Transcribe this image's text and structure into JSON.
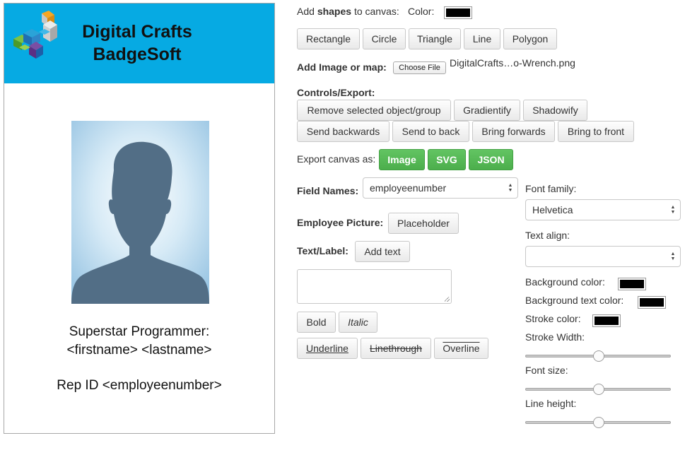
{
  "badge": {
    "brand_line1": "Digital Crafts",
    "brand_line2": "BadgeSoft",
    "title_line": "Superstar Programmer:",
    "name_line": "<firstname> <lastname>",
    "rep_line": "Rep ID <employeenumber>",
    "header_color": "#06aae3",
    "photo_bg_color": "#9cc9e6",
    "silhouette_color": "#526e86"
  },
  "shapes": {
    "label_prefix": "Add ",
    "label_bold": "shapes",
    "label_suffix": " to canvas:",
    "color_label": "Color:",
    "color_value": "#000000",
    "buttons": [
      "Rectangle",
      "Circle",
      "Triangle",
      "Line",
      "Polygon"
    ]
  },
  "image": {
    "label": "Add Image or map:",
    "choose_file": "Choose File",
    "file_name": "DigitalCrafts…o-Wrench.png"
  },
  "controls": {
    "label": "Controls/Export:",
    "row1": [
      "Remove selected object/group",
      "Gradientify",
      "Shadowify"
    ],
    "row2": [
      "Send backwards",
      "Send to back",
      "Bring forwards",
      "Bring to front"
    ]
  },
  "export": {
    "label": "Export canvas as:",
    "buttons": [
      "Image",
      "SVG",
      "JSON"
    ],
    "button_color": "#5cb85c"
  },
  "fields": {
    "field_names_label": "Field Names:",
    "field_names_value": "employeenumber",
    "employee_picture_label": "Employee Picture:",
    "placeholder_button": "Placeholder",
    "text_label": "Text/Label:",
    "add_text_button": "Add text",
    "textarea_value": ""
  },
  "style_buttons": {
    "bold": "Bold",
    "italic": "Italic",
    "underline": "Underline",
    "linethrough": "Linethrough",
    "overline": "Overline"
  },
  "text_props": {
    "font_family_label": "Font family:",
    "font_family_value": "Helvetica",
    "text_align_label": "Text align:",
    "text_align_value": "",
    "background_color_label": "Background color:",
    "background_text_color_label": "Background text color:",
    "stroke_color_label": "Stroke color:",
    "stroke_width_label": "Stroke Width:",
    "font_size_label": "Font size:",
    "line_height_label": "Line height:",
    "background_color": "#000000",
    "background_text_color": "#000000",
    "stroke_color": "#000000",
    "stroke_width_level": 0.5,
    "font_size_level": 0.5,
    "line_height_level": 0.5
  }
}
